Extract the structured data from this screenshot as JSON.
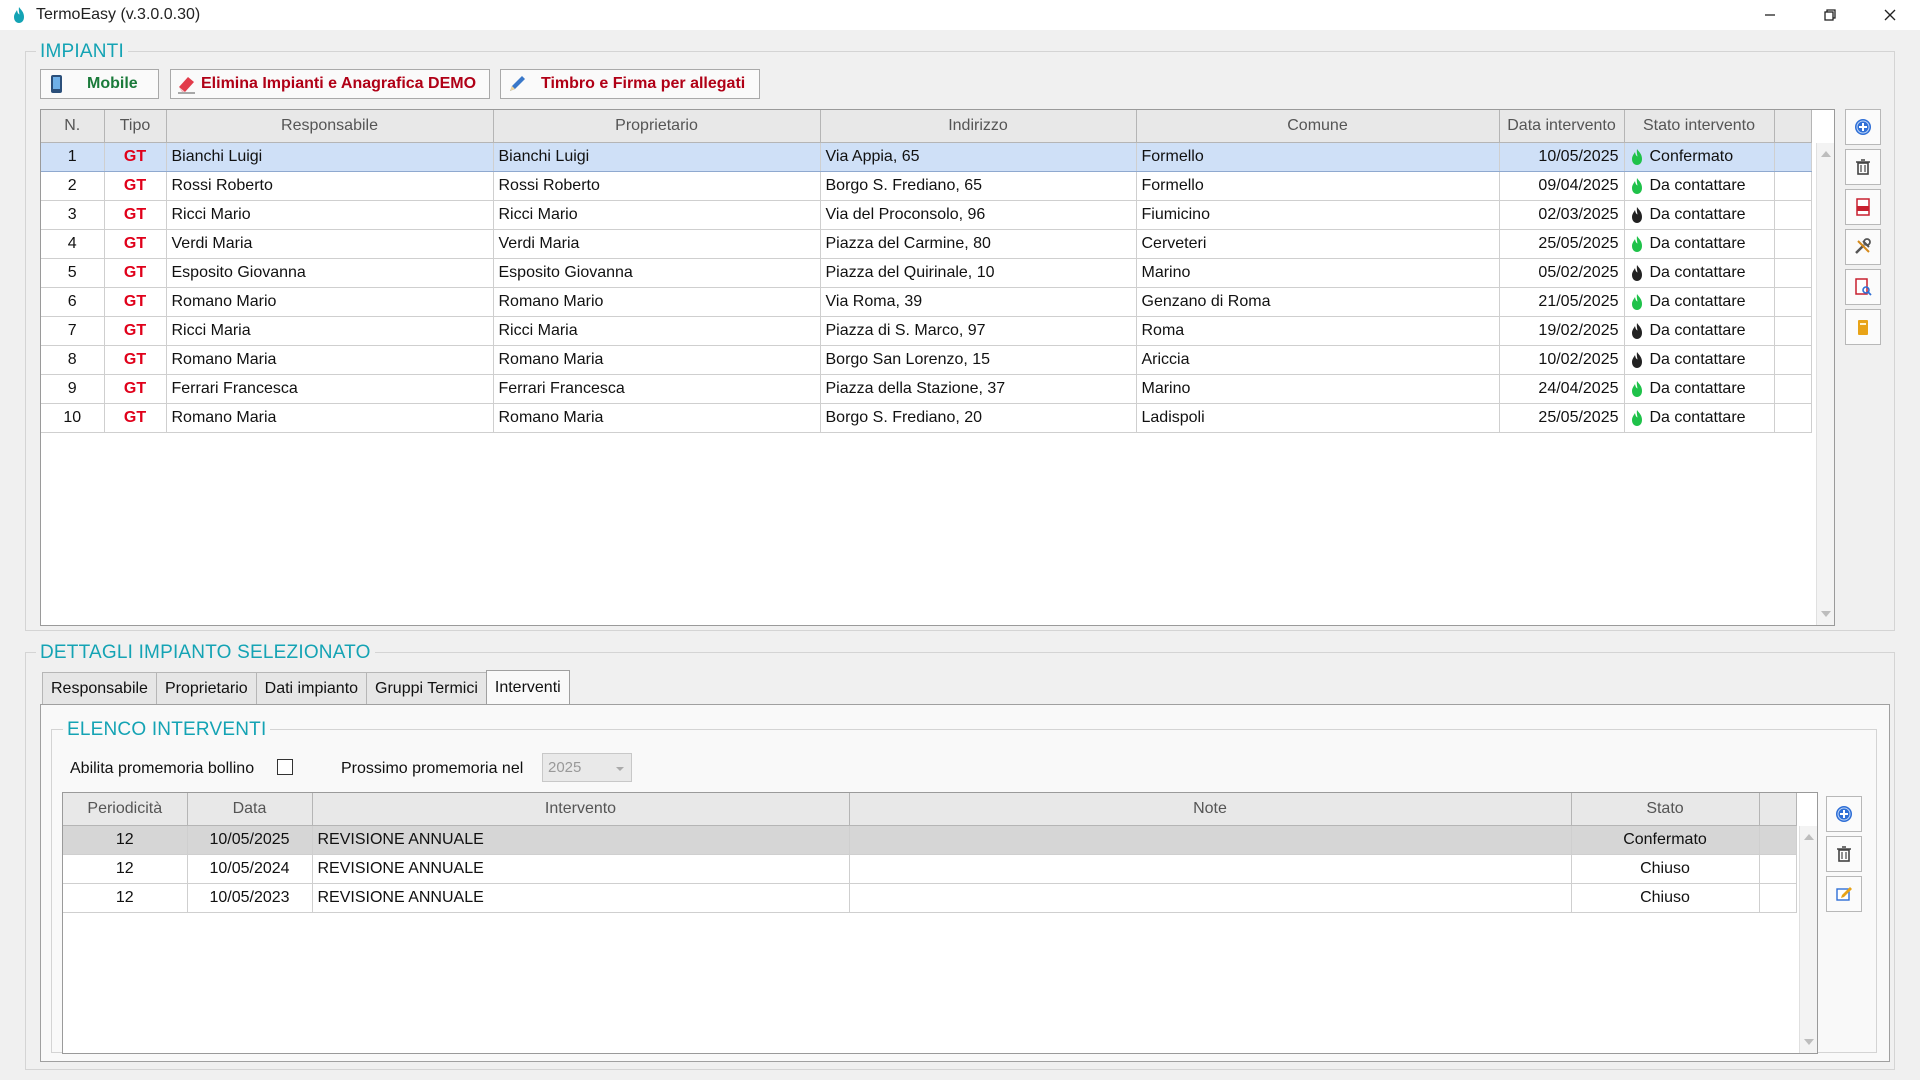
{
  "window": {
    "title": "TermoEasy (v.3.0.0.30)"
  },
  "impianti": {
    "legend": "IMPIANTI",
    "buttons": {
      "mobile": "Mobile",
      "elimina": "Elimina Impianti e Anagrafica DEMO",
      "timbro": "Timbro e Firma per allegati"
    },
    "columns": [
      "N.",
      "Tipo",
      "Responsabile",
      "Proprietario",
      "Indirizzo",
      "Comune",
      "Data intervento",
      "Stato intervento"
    ],
    "rows": [
      {
        "n": "1",
        "tipo": "GT",
        "responsabile": "Bianchi Luigi",
        "proprietario": "Bianchi Luigi",
        "indirizzo": "Via Appia, 65",
        "comune": "Formello",
        "data": "10/05/2025",
        "stato": "Confermato",
        "flame": "green"
      },
      {
        "n": "2",
        "tipo": "GT",
        "responsabile": "Rossi Roberto",
        "proprietario": "Rossi Roberto",
        "indirizzo": "Borgo S. Frediano, 65",
        "comune": "Formello",
        "data": "09/04/2025",
        "stato": "Da contattare",
        "flame": "green"
      },
      {
        "n": "3",
        "tipo": "GT",
        "responsabile": "Ricci Mario",
        "proprietario": "Ricci Mario",
        "indirizzo": "Via del Proconsolo, 96",
        "comune": "Fiumicino",
        "data": "02/03/2025",
        "stato": "Da contattare",
        "flame": "black"
      },
      {
        "n": "4",
        "tipo": "GT",
        "responsabile": "Verdi Maria",
        "proprietario": "Verdi Maria",
        "indirizzo": "Piazza del Carmine, 80",
        "comune": "Cerveteri",
        "data": "25/05/2025",
        "stato": "Da contattare",
        "flame": "green"
      },
      {
        "n": "5",
        "tipo": "GT",
        "responsabile": "Esposito Giovanna",
        "proprietario": "Esposito Giovanna",
        "indirizzo": "Piazza del Quirinale, 10",
        "comune": "Marino",
        "data": "05/02/2025",
        "stato": "Da contattare",
        "flame": "black"
      },
      {
        "n": "6",
        "tipo": "GT",
        "responsabile": "Romano Mario",
        "proprietario": "Romano Mario",
        "indirizzo": "Via Roma, 39",
        "comune": "Genzano di Roma",
        "data": "21/05/2025",
        "stato": "Da contattare",
        "flame": "green"
      },
      {
        "n": "7",
        "tipo": "GT",
        "responsabile": "Ricci Maria",
        "proprietario": "Ricci Maria",
        "indirizzo": "Piazza di S. Marco, 97",
        "comune": "Roma",
        "data": "19/02/2025",
        "stato": "Da contattare",
        "flame": "black"
      },
      {
        "n": "8",
        "tipo": "GT",
        "responsabile": "Romano Maria",
        "proprietario": "Romano Maria",
        "indirizzo": "Borgo San Lorenzo, 15",
        "comune": "Ariccia",
        "data": "10/02/2025",
        "stato": "Da contattare",
        "flame": "black"
      },
      {
        "n": "9",
        "tipo": "GT",
        "responsabile": "Ferrari Francesca",
        "proprietario": "Ferrari Francesca",
        "indirizzo": "Piazza della Stazione, 37",
        "comune": "Marino",
        "data": "24/04/2025",
        "stato": "Da contattare",
        "flame": "green"
      },
      {
        "n": "10",
        "tipo": "GT",
        "responsabile": "Romano Maria",
        "proprietario": "Romano Maria",
        "indirizzo": "Borgo S. Frediano, 20",
        "comune": "Ladispoli",
        "data": "25/05/2025",
        "stato": "Da contattare",
        "flame": "green"
      }
    ],
    "side_icons": [
      "add-circle-icon",
      "trash-icon",
      "pdf-icon",
      "tools-icon",
      "document-search-icon",
      "archive-icon"
    ]
  },
  "dettagli": {
    "legend": "DETTAGLI IMPIANTO SELEZIONATO",
    "tabs": [
      "Responsabile",
      "Proprietario",
      "Dati impianto",
      "Gruppi Termici",
      "Interventi"
    ],
    "active_tab": "Interventi",
    "elenco": {
      "legend": "ELENCO INTERVENTI",
      "abilita_label": "Abilita promemoria bollino",
      "abilita_checked": false,
      "prossimo_label": "Prossimo promemoria nel",
      "prossimo_value": "2025",
      "columns": [
        "Periodicità",
        "Data",
        "Intervento",
        "Note",
        "Stato"
      ],
      "rows": [
        {
          "periodicita": "12",
          "data": "10/05/2025",
          "intervento": "REVISIONE ANNUALE",
          "note": "",
          "stato": "Confermato"
        },
        {
          "periodicita": "12",
          "data": "10/05/2024",
          "intervento": "REVISIONE ANNUALE",
          "note": "",
          "stato": "Chiuso"
        },
        {
          "periodicita": "12",
          "data": "10/05/2023",
          "intervento": "REVISIONE ANNUALE",
          "note": "",
          "stato": "Chiuso"
        }
      ],
      "side_icons": [
        "add-circle-icon",
        "trash-icon",
        "edit-icon"
      ]
    }
  },
  "colors": {
    "accent": "#14a3b4",
    "gt_red": "#e0001a",
    "flame_green": "#1fc24a",
    "flame_black": "#222222",
    "selection": "#cfe0f7"
  }
}
